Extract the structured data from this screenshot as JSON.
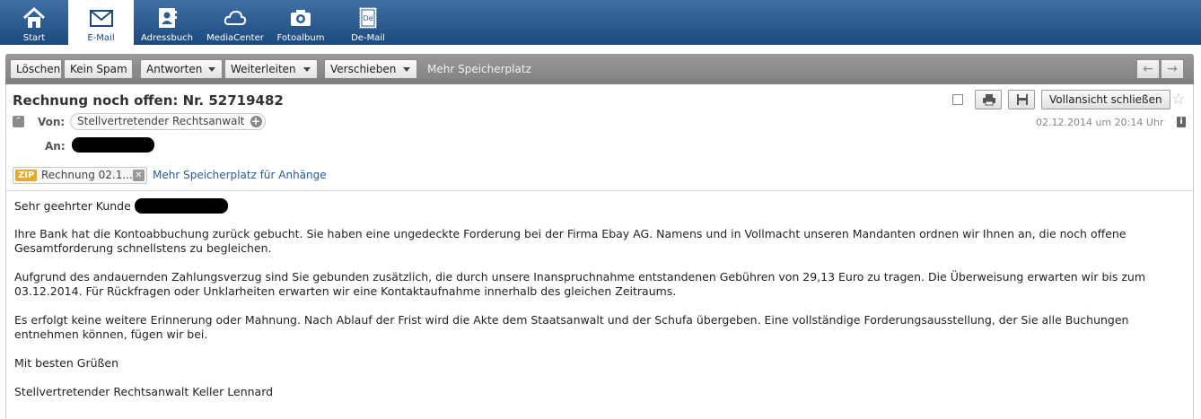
{
  "nav": {
    "items": [
      {
        "label": "Start",
        "icon": "home-icon",
        "active": false
      },
      {
        "label": "E-Mail",
        "icon": "envelope-icon",
        "active": true
      },
      {
        "label": "Adressbuch",
        "icon": "address-book-icon",
        "active": false
      },
      {
        "label": "MediaCenter",
        "icon": "cloud-icon",
        "active": false
      },
      {
        "label": "Fotoalbum",
        "icon": "camera-icon",
        "active": false
      },
      {
        "label": "De-Mail",
        "icon": "de-mail-stamp-icon",
        "active": false
      }
    ]
  },
  "toolbar": {
    "delete_label": "Löschen",
    "nospam_label": "Kein Spam",
    "reply_label": "Antworten",
    "forward_label": "Weiterleiten",
    "move_label": "Verschieben",
    "storage_text": "Mehr Speicherplatz",
    "prev_icon": "arrow-left-icon",
    "next_icon": "arrow-right-icon"
  },
  "message": {
    "subject": "Rechnung noch offen: Nr. 52719482",
    "from_label": "Von:",
    "from_name": "Stellvertretender Rechtsanwalt",
    "to_label": "An:",
    "date": "02.12.2014 um 20:14 Uhr",
    "close_fullview_label": "Vollansicht schließen",
    "attachment": {
      "type": "ZIP",
      "name": "Rechnung 02.1..."
    },
    "more_storage_link": "Mehr Speicherplatz für Anhänge",
    "body": [
      "Sehr geehrter Kunde",
      "Ihre Bank hat die Kontoabbuchung zurück gebucht. Sie haben eine ungedeckte Forderung bei der Firma Ebay AG. Namens und in Vollmacht unseren Mandanten ordnen wir Ihnen an, die noch offene Gesamtforderung schnellstens zu begleichen.",
      "Aufgrund des andauernden Zahlungsverzug sind Sie gebunden zusätzlich, die durch unsere Inanspruchnahme entstandenen Gebühren von 29,13 Euro zu tragen. Die Überweisung erwarten wir bis zum 03.12.2014. Für Rückfragen oder Unklarheiten erwarten wir eine Kontaktaufnahme innerhalb des gleichen Zeitraums.",
      "Es erfolgt keine weitere Erinnerung oder Mahnung. Nach Ablauf der Frist wird die Akte dem Staatsanwalt und der Schufa übergeben. Eine vollständige Forderungsausstellung, der Sie alle Buchungen entnehmen können, fügen wir bei.",
      "Mit besten Grüßen",
      "Stellvertretender Rechtsanwalt Keller Lennard"
    ]
  },
  "colors": {
    "nav_top": "#3f6fa3",
    "nav_bottom": "#1d4a7e",
    "toolbar": "#8c8c8c",
    "link": "#2a5d97",
    "zip_badge": "#e8a92c"
  }
}
